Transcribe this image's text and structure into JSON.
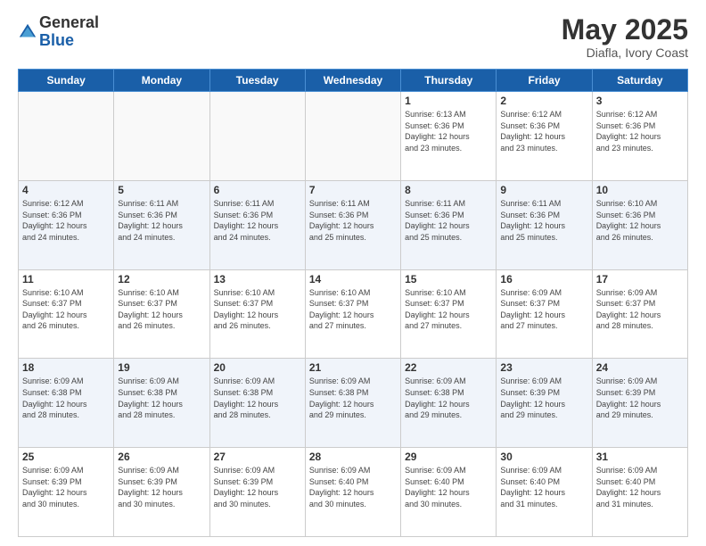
{
  "logo": {
    "general": "General",
    "blue": "Blue"
  },
  "header": {
    "month": "May 2025",
    "location": "Diafla, Ivory Coast"
  },
  "weekdays": [
    "Sunday",
    "Monday",
    "Tuesday",
    "Wednesday",
    "Thursday",
    "Friday",
    "Saturday"
  ],
  "weeks": [
    [
      {
        "day": "",
        "info": ""
      },
      {
        "day": "",
        "info": ""
      },
      {
        "day": "",
        "info": ""
      },
      {
        "day": "",
        "info": ""
      },
      {
        "day": "1",
        "info": "Sunrise: 6:13 AM\nSunset: 6:36 PM\nDaylight: 12 hours\nand 23 minutes."
      },
      {
        "day": "2",
        "info": "Sunrise: 6:12 AM\nSunset: 6:36 PM\nDaylight: 12 hours\nand 23 minutes."
      },
      {
        "day": "3",
        "info": "Sunrise: 6:12 AM\nSunset: 6:36 PM\nDaylight: 12 hours\nand 23 minutes."
      }
    ],
    [
      {
        "day": "4",
        "info": "Sunrise: 6:12 AM\nSunset: 6:36 PM\nDaylight: 12 hours\nand 24 minutes."
      },
      {
        "day": "5",
        "info": "Sunrise: 6:11 AM\nSunset: 6:36 PM\nDaylight: 12 hours\nand 24 minutes."
      },
      {
        "day": "6",
        "info": "Sunrise: 6:11 AM\nSunset: 6:36 PM\nDaylight: 12 hours\nand 24 minutes."
      },
      {
        "day": "7",
        "info": "Sunrise: 6:11 AM\nSunset: 6:36 PM\nDaylight: 12 hours\nand 25 minutes."
      },
      {
        "day": "8",
        "info": "Sunrise: 6:11 AM\nSunset: 6:36 PM\nDaylight: 12 hours\nand 25 minutes."
      },
      {
        "day": "9",
        "info": "Sunrise: 6:11 AM\nSunset: 6:36 PM\nDaylight: 12 hours\nand 25 minutes."
      },
      {
        "day": "10",
        "info": "Sunrise: 6:10 AM\nSunset: 6:36 PM\nDaylight: 12 hours\nand 26 minutes."
      }
    ],
    [
      {
        "day": "11",
        "info": "Sunrise: 6:10 AM\nSunset: 6:37 PM\nDaylight: 12 hours\nand 26 minutes."
      },
      {
        "day": "12",
        "info": "Sunrise: 6:10 AM\nSunset: 6:37 PM\nDaylight: 12 hours\nand 26 minutes."
      },
      {
        "day": "13",
        "info": "Sunrise: 6:10 AM\nSunset: 6:37 PM\nDaylight: 12 hours\nand 26 minutes."
      },
      {
        "day": "14",
        "info": "Sunrise: 6:10 AM\nSunset: 6:37 PM\nDaylight: 12 hours\nand 27 minutes."
      },
      {
        "day": "15",
        "info": "Sunrise: 6:10 AM\nSunset: 6:37 PM\nDaylight: 12 hours\nand 27 minutes."
      },
      {
        "day": "16",
        "info": "Sunrise: 6:09 AM\nSunset: 6:37 PM\nDaylight: 12 hours\nand 27 minutes."
      },
      {
        "day": "17",
        "info": "Sunrise: 6:09 AM\nSunset: 6:37 PM\nDaylight: 12 hours\nand 28 minutes."
      }
    ],
    [
      {
        "day": "18",
        "info": "Sunrise: 6:09 AM\nSunset: 6:38 PM\nDaylight: 12 hours\nand 28 minutes."
      },
      {
        "day": "19",
        "info": "Sunrise: 6:09 AM\nSunset: 6:38 PM\nDaylight: 12 hours\nand 28 minutes."
      },
      {
        "day": "20",
        "info": "Sunrise: 6:09 AM\nSunset: 6:38 PM\nDaylight: 12 hours\nand 28 minutes."
      },
      {
        "day": "21",
        "info": "Sunrise: 6:09 AM\nSunset: 6:38 PM\nDaylight: 12 hours\nand 29 minutes."
      },
      {
        "day": "22",
        "info": "Sunrise: 6:09 AM\nSunset: 6:38 PM\nDaylight: 12 hours\nand 29 minutes."
      },
      {
        "day": "23",
        "info": "Sunrise: 6:09 AM\nSunset: 6:39 PM\nDaylight: 12 hours\nand 29 minutes."
      },
      {
        "day": "24",
        "info": "Sunrise: 6:09 AM\nSunset: 6:39 PM\nDaylight: 12 hours\nand 29 minutes."
      }
    ],
    [
      {
        "day": "25",
        "info": "Sunrise: 6:09 AM\nSunset: 6:39 PM\nDaylight: 12 hours\nand 30 minutes."
      },
      {
        "day": "26",
        "info": "Sunrise: 6:09 AM\nSunset: 6:39 PM\nDaylight: 12 hours\nand 30 minutes."
      },
      {
        "day": "27",
        "info": "Sunrise: 6:09 AM\nSunset: 6:39 PM\nDaylight: 12 hours\nand 30 minutes."
      },
      {
        "day": "28",
        "info": "Sunrise: 6:09 AM\nSunset: 6:40 PM\nDaylight: 12 hours\nand 30 minutes."
      },
      {
        "day": "29",
        "info": "Sunrise: 6:09 AM\nSunset: 6:40 PM\nDaylight: 12 hours\nand 30 minutes."
      },
      {
        "day": "30",
        "info": "Sunrise: 6:09 AM\nSunset: 6:40 PM\nDaylight: 12 hours\nand 31 minutes."
      },
      {
        "day": "31",
        "info": "Sunrise: 6:09 AM\nSunset: 6:40 PM\nDaylight: 12 hours\nand 31 minutes."
      }
    ]
  ]
}
